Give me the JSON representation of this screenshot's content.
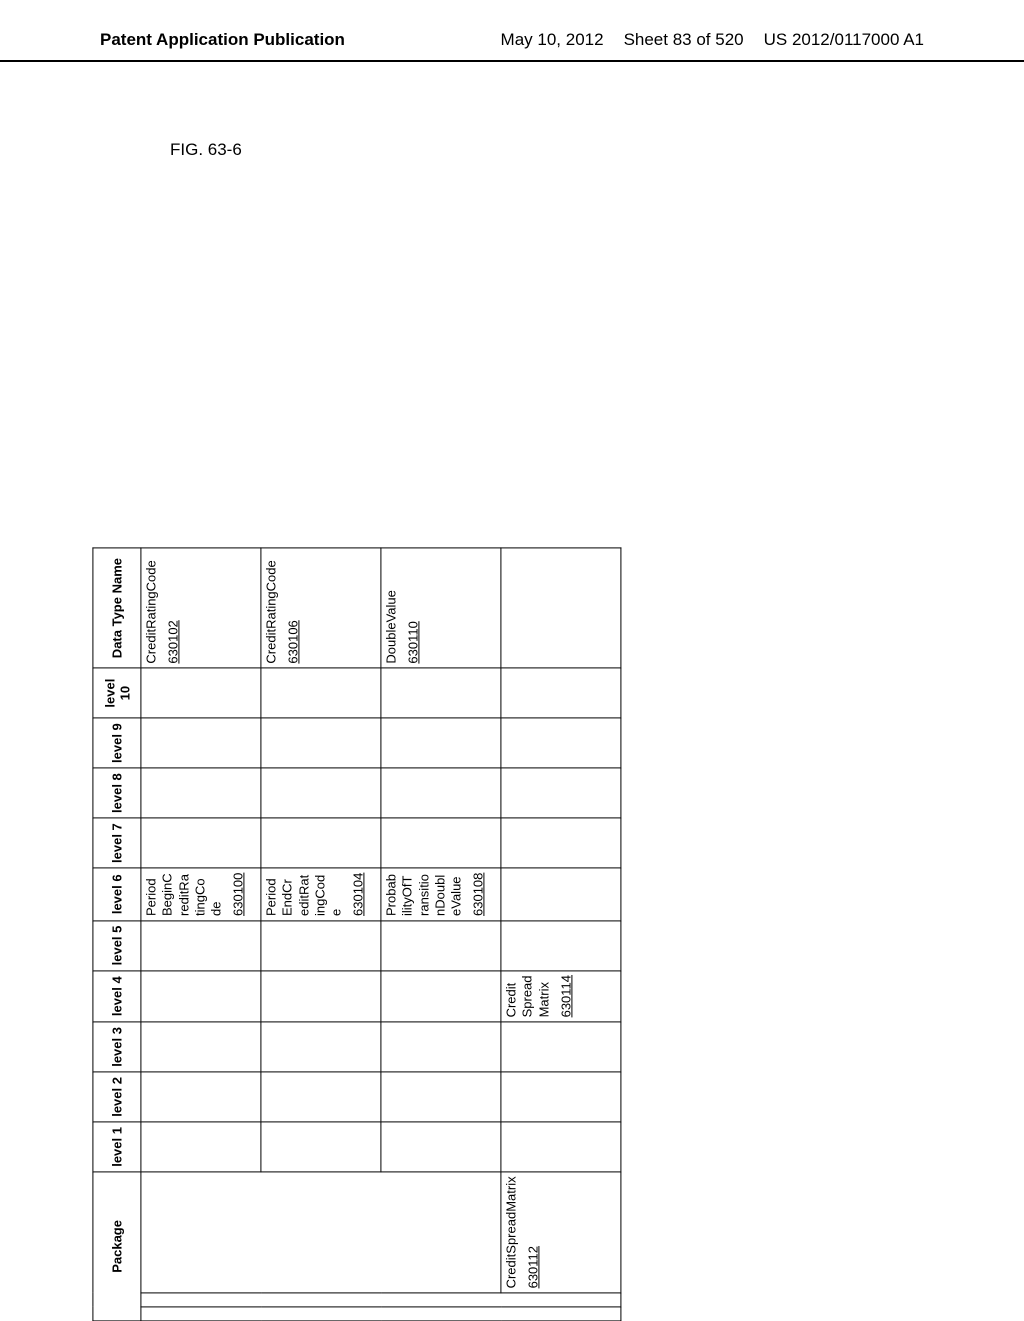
{
  "header": {
    "left": "Patent Application Publication",
    "date": "May 10, 2012",
    "sheet": "Sheet 83 of 520",
    "pubno": "US 2012/0117000 A1"
  },
  "figure_label": "FIG. 63-6",
  "table": {
    "columns": {
      "package": "Package",
      "level1": "level 1",
      "level2": "level 2",
      "level3": "level 3",
      "level4": "level 4",
      "level5": "level 5",
      "level6": "level 6",
      "level7": "level 7",
      "level8": "level 8",
      "level9": "level 9",
      "level10": "level 10",
      "datatype": "Data Type Name"
    },
    "rows": [
      {
        "level6": "PeriodBeginCreditRatingCode",
        "level6_ref": "630100",
        "datatype": "CreditRatingCode",
        "datatype_ref": "630102"
      },
      {
        "level6": "PeriodEndCreditRatingCode",
        "level6_ref": "630104",
        "datatype": "CreditRatingCode",
        "datatype_ref": "630106"
      },
      {
        "level6": "ProbabilityOfTransitionDoubleValue",
        "level6_ref": "630108",
        "datatype": "DoubleValue",
        "datatype_ref": "630110"
      },
      {
        "package": "CreditSpreadMatrix",
        "package_ref": "630112",
        "level4": "CreditSpreadMatrix",
        "level4_ref": "630114"
      }
    ]
  }
}
